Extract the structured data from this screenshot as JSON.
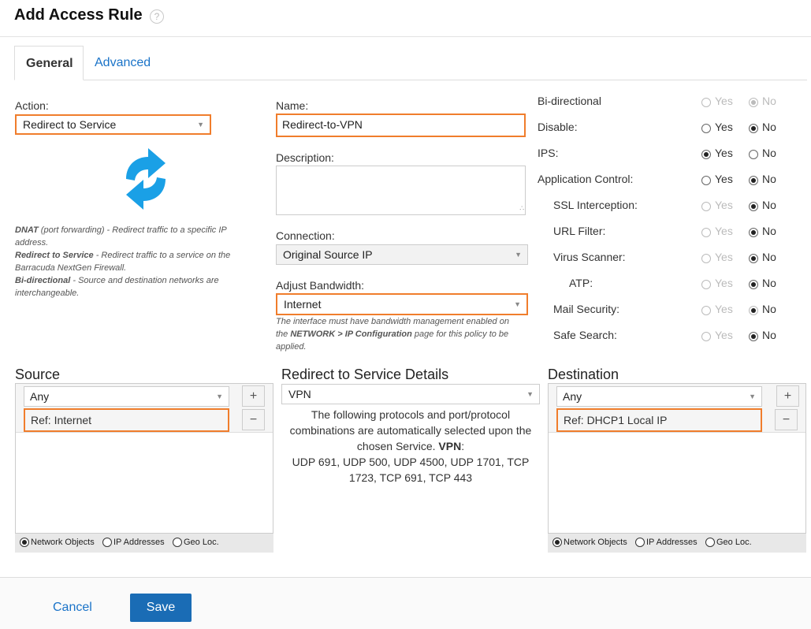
{
  "header": {
    "title": "Add Access Rule",
    "help_glyph": "?"
  },
  "tabs": [
    {
      "label": "General"
    },
    {
      "label": "Advanced"
    }
  ],
  "action": {
    "label": "Action:",
    "value": "Redirect to Service",
    "icon": "redirect-arrows-icon"
  },
  "help": {
    "dnat_term": "DNAT",
    "dnat_text": " (port forwarding) - Redirect traffic to a specific IP address.",
    "redirect_term": "Redirect to Service",
    "redirect_text": " - Redirect traffic to a service on the Barracuda NextGen Firewall.",
    "bidir_term": "Bi-directional",
    "bidir_text": " - Source and destination networks are interchangeable."
  },
  "name": {
    "label": "Name:",
    "value": "Redirect-to-VPN"
  },
  "description": {
    "label": "Description:",
    "value": ""
  },
  "connection": {
    "label": "Connection:",
    "value": "Original Source IP"
  },
  "bandwidth": {
    "label": "Adjust Bandwidth:",
    "value": "Internet",
    "note_pre": "The interface must have bandwidth management enabled on the ",
    "note_bold": "NETWORK > IP Configuration",
    "note_post": " page for this policy to be applied."
  },
  "options": {
    "yes": "Yes",
    "no": "No",
    "rows": [
      {
        "label": "Bi-directional",
        "selected": "No",
        "disabled": true
      },
      {
        "label": "Disable:",
        "selected": "No",
        "disabled": false
      },
      {
        "label": "IPS:",
        "selected": "Yes",
        "disabled": false
      },
      {
        "label": "Application Control:",
        "selected": "No",
        "disabled": false
      },
      {
        "label": "SSL Interception:",
        "selected": "No",
        "disabled": false
      },
      {
        "label": "URL Filter:",
        "selected": "No",
        "disabled": false
      },
      {
        "label": "Virus Scanner:",
        "selected": "No",
        "disabled": false
      },
      {
        "label": "ATP:",
        "selected": "No",
        "disabled": false
      },
      {
        "label": "Mail Security:",
        "selected": "No",
        "disabled": true
      },
      {
        "label": "Safe Search:",
        "selected": "No",
        "disabled": false
      }
    ]
  },
  "source": {
    "title": "Source",
    "select_value": "Any",
    "item": "Ref: Internet",
    "add": "+",
    "remove": "−",
    "radio": [
      "Network Objects",
      "IP Addresses",
      "Geo Loc."
    ],
    "radio_selected": "Network Objects"
  },
  "service": {
    "title": "Redirect to Service Details",
    "select_value": "VPN",
    "desc_pre": "The following protocols and port/protocol combinations are automatically selected upon the chosen Service. ",
    "desc_bold": "VPN",
    "desc_colon": ":",
    "desc_ports": "UDP 691, UDP 500, UDP 4500, UDP 1701, TCP 1723, TCP 691, TCP 443"
  },
  "destination": {
    "title": "Destination",
    "select_value": "Any",
    "item": "Ref: DHCP1 Local IP",
    "add": "+",
    "remove": "−",
    "radio": [
      "Network Objects",
      "IP Addresses",
      "Geo Loc."
    ],
    "radio_selected": "Network Objects"
  },
  "footer": {
    "cancel": "Cancel",
    "save": "Save"
  },
  "colors": {
    "accent": "#1a73c8",
    "highlight": "#f07d2c",
    "icon": "#1aa0e6"
  }
}
